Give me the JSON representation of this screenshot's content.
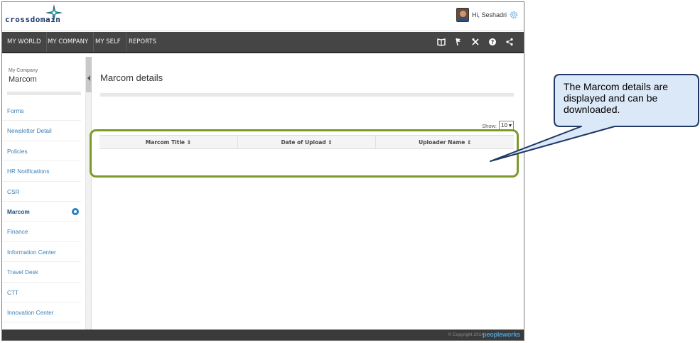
{
  "header": {
    "logo_text": "crossdomain",
    "greeting": "Hi, Seshadri"
  },
  "nav": {
    "items": [
      "MY WORLD",
      "MY COMPANY",
      "MY SELF",
      "REPORTS"
    ],
    "icons": [
      "book-icon",
      "flag-icon",
      "tools-icon",
      "help-icon",
      "share-icon"
    ]
  },
  "sidebar": {
    "breadcrumb_small": "My Company",
    "breadcrumb_title": "Marcom",
    "items": [
      {
        "label": "Forms"
      },
      {
        "label": "Newsletter Detail"
      },
      {
        "label": "Policies"
      },
      {
        "label": "HR Notifications"
      },
      {
        "label": "CSR"
      },
      {
        "label": "Marcom",
        "active": true
      },
      {
        "label": "Finance"
      },
      {
        "label": "Information Center"
      },
      {
        "label": "Travel Desk"
      },
      {
        "label": "CTT"
      },
      {
        "label": "Innovation Center"
      }
    ]
  },
  "main": {
    "title": "Marcom details",
    "show_label": "Show:",
    "show_value": "10",
    "columns": [
      "Marcom Title ⇕",
      "Date of Upload ⇕",
      "Uploader Name ⇕"
    ]
  },
  "footer": {
    "copyright": "© Copyright 2014",
    "brand": "peopleworks"
  },
  "callout": {
    "text": "The Marcom details are displayed and can be downloaded."
  },
  "colors": {
    "navbar": "#454545",
    "highlight": "#7a9a2a",
    "callout_fill": "#dbe8f7",
    "callout_border": "#1f3864",
    "link": "#3a7fb8"
  }
}
